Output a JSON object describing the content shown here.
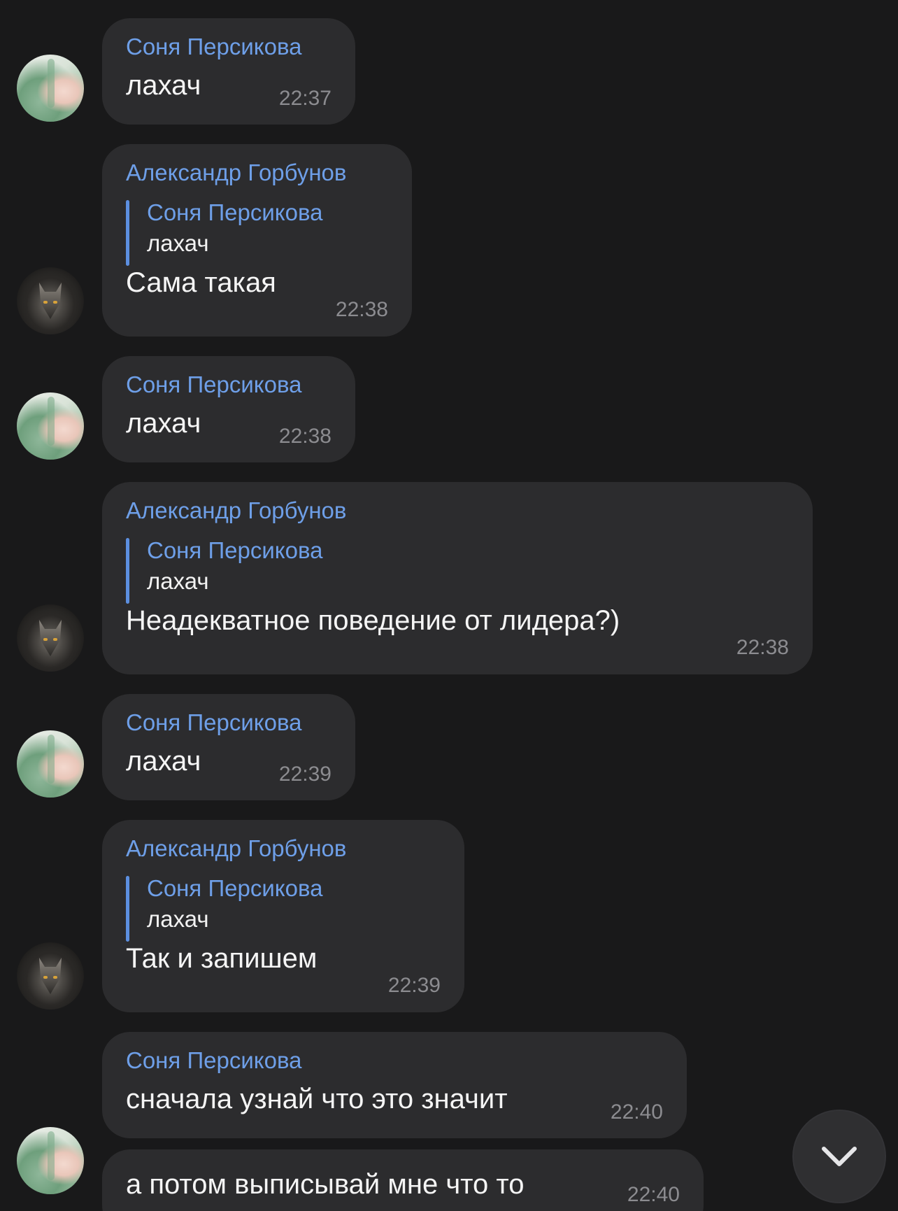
{
  "messages": [
    {
      "sender": "Соня Персикова",
      "text": "лахач",
      "time": "22:37"
    },
    {
      "sender": "Александр Горбунов",
      "reply_to": {
        "sender": "Соня Персикова",
        "text": "лахач"
      },
      "text": "Сама такая",
      "time": "22:38"
    },
    {
      "sender": "Соня Персикова",
      "text": "лахач",
      "time": "22:38"
    },
    {
      "sender": "Александр Горбунов",
      "reply_to": {
        "sender": "Соня Персикова",
        "text": "лахач"
      },
      "text": "Неадекватное поведение от лидера?)",
      "time": "22:38"
    },
    {
      "sender": "Соня Персикова",
      "text": "лахач",
      "time": "22:39"
    },
    {
      "sender": "Александр Горбунов",
      "reply_to": {
        "sender": "Соня Персикова",
        "text": "лахач"
      },
      "text": "Так и запишем",
      "time": "22:39"
    },
    {
      "sender": "Соня Персикова",
      "text": "сначала узнай что это значит",
      "time": "22:40"
    },
    {
      "text": "а потом выписывай мне что то",
      "time": "22:40"
    }
  ],
  "colors": {
    "background": "#19191a",
    "bubble": "#2c2c2e",
    "sender_name": "#6e9fe8",
    "reply_bar": "#5c8fe0",
    "timestamp": "#8c8c90"
  },
  "scroll_down_button": {
    "icon": "chevron-down-icon"
  }
}
